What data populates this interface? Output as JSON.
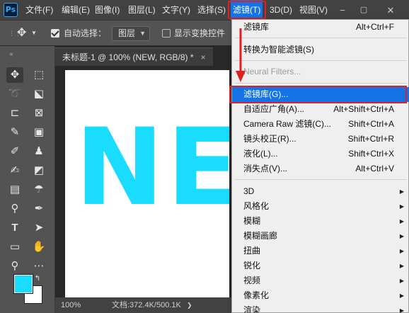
{
  "menubar": {
    "logo": "Ps",
    "items": [
      "文件(F)",
      "编辑(E)",
      "图像(I)",
      "图层(L)",
      "文字(Y)",
      "选择(S)",
      "滤镜(T)",
      "3D(D)",
      "视图(V)"
    ],
    "win_min": "−",
    "win_restore": "▢",
    "win_close": "✕"
  },
  "options": {
    "auto_select_label": "自动选择：",
    "auto_select_value": "图层",
    "show_transform_label": "显示变换控件"
  },
  "document": {
    "tab_title": "未标题-1 @ 100% (NEW, RGB/8) *",
    "tab_close": "×",
    "canvas_text": "NE",
    "canvas_text_color": "#1adcff",
    "zoom": "100%",
    "doc_info": "文档:372.4K/500.1K"
  },
  "filter_menu": {
    "items": [
      {
        "label": "滤镜库",
        "shortcut": "Alt+Ctrl+F"
      },
      {
        "label": "转换为智能滤镜(S)",
        "shortcut": ""
      },
      {
        "label": "Neural Filters...",
        "shortcut": ""
      },
      {
        "label": "滤镜库(G)...",
        "shortcut": ""
      },
      {
        "label": "自适应广角(A)...",
        "shortcut": "Alt+Shift+Ctrl+A"
      },
      {
        "label": "Camera Raw 滤镜(C)...",
        "shortcut": "Shift+Ctrl+A"
      },
      {
        "label": "镜头校正(R)...",
        "shortcut": "Shift+Ctrl+R"
      },
      {
        "label": "液化(L)...",
        "shortcut": "Shift+Ctrl+X"
      },
      {
        "label": "消失点(V)...",
        "shortcut": "Alt+Ctrl+V"
      },
      {
        "label": "3D"
      },
      {
        "label": "风格化"
      },
      {
        "label": "模糊"
      },
      {
        "label": "模糊画廊"
      },
      {
        "label": "扭曲"
      },
      {
        "label": "锐化"
      },
      {
        "label": "视频"
      },
      {
        "label": "像素化"
      },
      {
        "label": "渲染"
      }
    ],
    "submenu_arrow": "▶"
  },
  "colors": {
    "accent": "#1473e6",
    "highlight_box": "#e02020",
    "foreground_color": "#1adcff",
    "background_color": "#ffffff"
  }
}
